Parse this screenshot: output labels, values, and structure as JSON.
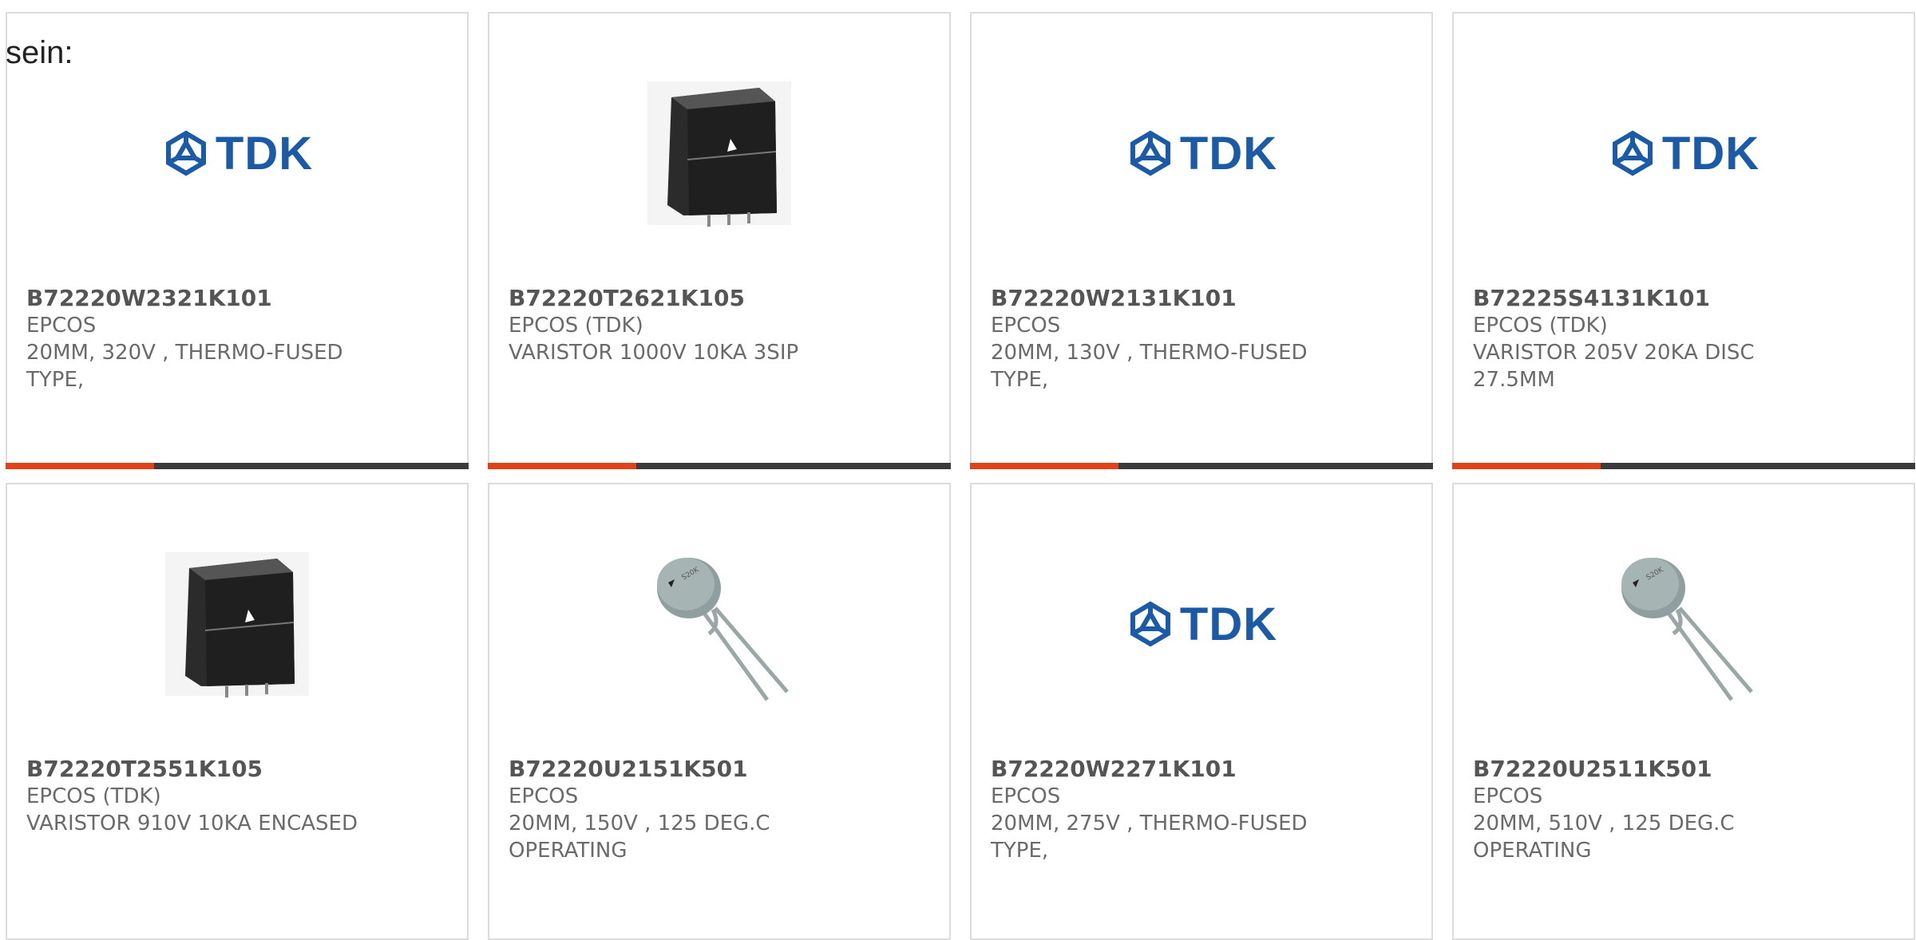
{
  "intro_text": "sein:",
  "brand_logo_text": "TDK",
  "colors": {
    "accent": "#e2411a",
    "bar_track": "#3b3b3b",
    "logo_blue": "#1a5aa6"
  },
  "products": [
    {
      "part_number": "B72220W2321K101",
      "manufacturer": "EPCOS",
      "description": "20MM, 320V , THERMO-FUSED TYPE,",
      "image": "tdk-logo",
      "progress": 0.32
    },
    {
      "part_number": "B72220T2621K105",
      "manufacturer": "EPCOS (TDK)",
      "description": "VARISTOR 1000V 10KA 3SIP",
      "image": "encased-varistor",
      "progress": 0.32
    },
    {
      "part_number": "B72220W2131K101",
      "manufacturer": "EPCOS",
      "description": "20MM, 130V , THERMO-FUSED TYPE,",
      "image": "tdk-logo",
      "progress": 0.32
    },
    {
      "part_number": "B72225S4131K101",
      "manufacturer": "EPCOS (TDK)",
      "description": "VARISTOR 205V 20KA DISC 27.5MM",
      "image": "tdk-logo",
      "progress": 0.32
    },
    {
      "part_number": "B72220T2551K105",
      "manufacturer": "EPCOS (TDK)",
      "description": "VARISTOR 910V 10KA ENCASED",
      "image": "encased-varistor",
      "progress": 0
    },
    {
      "part_number": "B72220U2151K501",
      "manufacturer": "EPCOS",
      "description": "20MM, 150V , 125 DEG.C OPERATING",
      "image": "disc-varistor",
      "progress": 0
    },
    {
      "part_number": "B72220W2271K101",
      "manufacturer": "EPCOS",
      "description": "20MM, 275V , THERMO-FUSED TYPE,",
      "image": "tdk-logo",
      "progress": 0
    },
    {
      "part_number": "B72220U2511K501",
      "manufacturer": "EPCOS",
      "description": "20MM, 510V , 125 DEG.C OPERATING",
      "image": "disc-varistor",
      "progress": 0
    }
  ]
}
